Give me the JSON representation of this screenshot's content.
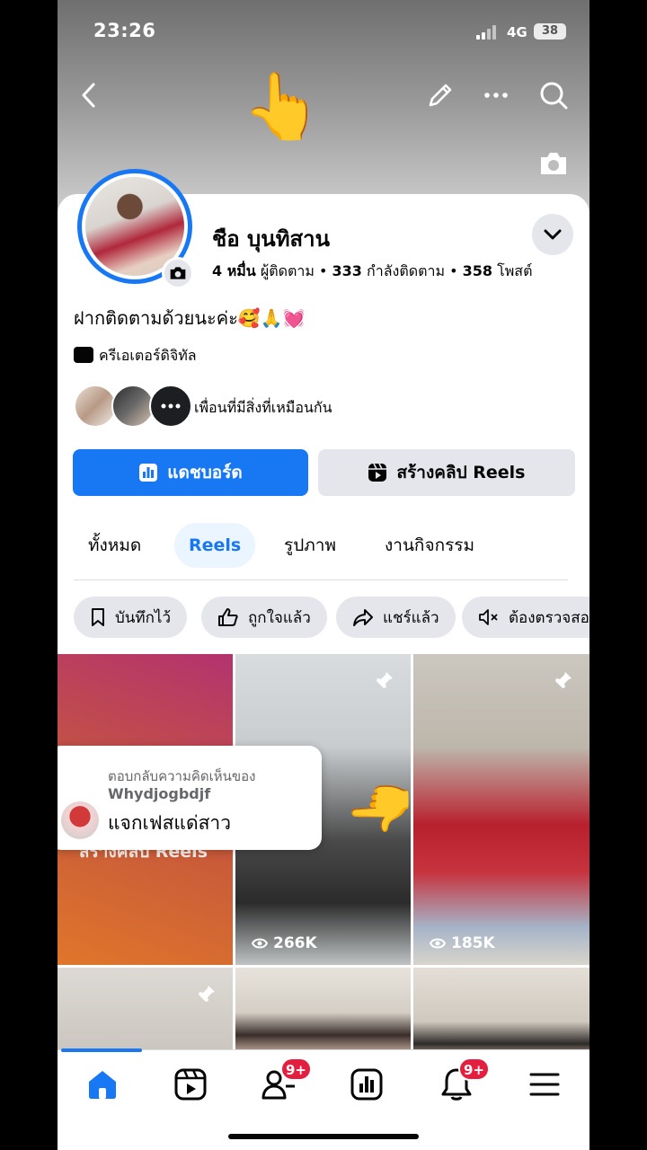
{
  "status": {
    "time": "23:26",
    "network": "4G",
    "battery": "38"
  },
  "header": {
    "icons": [
      "back-arrow-icon",
      "pencil-icon",
      "more-icon",
      "search-icon"
    ],
    "cover_overlay": "👆",
    "cover_camera_icon": "camera-icon"
  },
  "profile": {
    "name": "ชือ บุนทิสาน",
    "followers_count": "4 หมื่น",
    "followers_label": "ผู้ติดตาม",
    "following_count": "333",
    "following_label": "กำลังติดตาม",
    "posts_count": "358",
    "posts_label": "โพสต์",
    "separator": "•",
    "bio": "ฝากติดตามด้วยนะค่ะ🥰🙏💓",
    "category": "ครีเอเตอร์ดิจิทัล",
    "mutual_text": "เพื่อนที่มีสิ่งที่เหมือนกัน"
  },
  "actions": {
    "dashboard": "แดชบอร์ด",
    "create_reels": "สร้างคลิป Reels"
  },
  "tabs": [
    "ทั้งหมด",
    "Reels",
    "รูปภาพ",
    "งานกิจกรรม"
  ],
  "active_tab": "Reels",
  "chips": [
    "บันทึกไว้",
    "ถูกใจแล้ว",
    "แชร์แล้ว",
    "ต้องตรวจสอบ"
  ],
  "grid": {
    "create_caption": "สร้างคลิป Reels",
    "tiles": [
      {
        "views": "266K"
      },
      {
        "views": "185K"
      }
    ]
  },
  "comment_popup": {
    "title": "ตอบกลับความคิดเห็นของ",
    "user": "Whydjogbdjf",
    "text": "แจกเฟสแด่สาว"
  },
  "bottom_nav": {
    "items": [
      "home-icon",
      "reels-icon",
      "friends-icon",
      "dashboard-icon",
      "bell-icon",
      "menu-icon"
    ],
    "friends_badge": "9+",
    "notifications_badge": "9+"
  },
  "colors": {
    "accent": "#1877f2",
    "badge": "#e41e3f",
    "chip_bg": "#e4e6eb"
  }
}
